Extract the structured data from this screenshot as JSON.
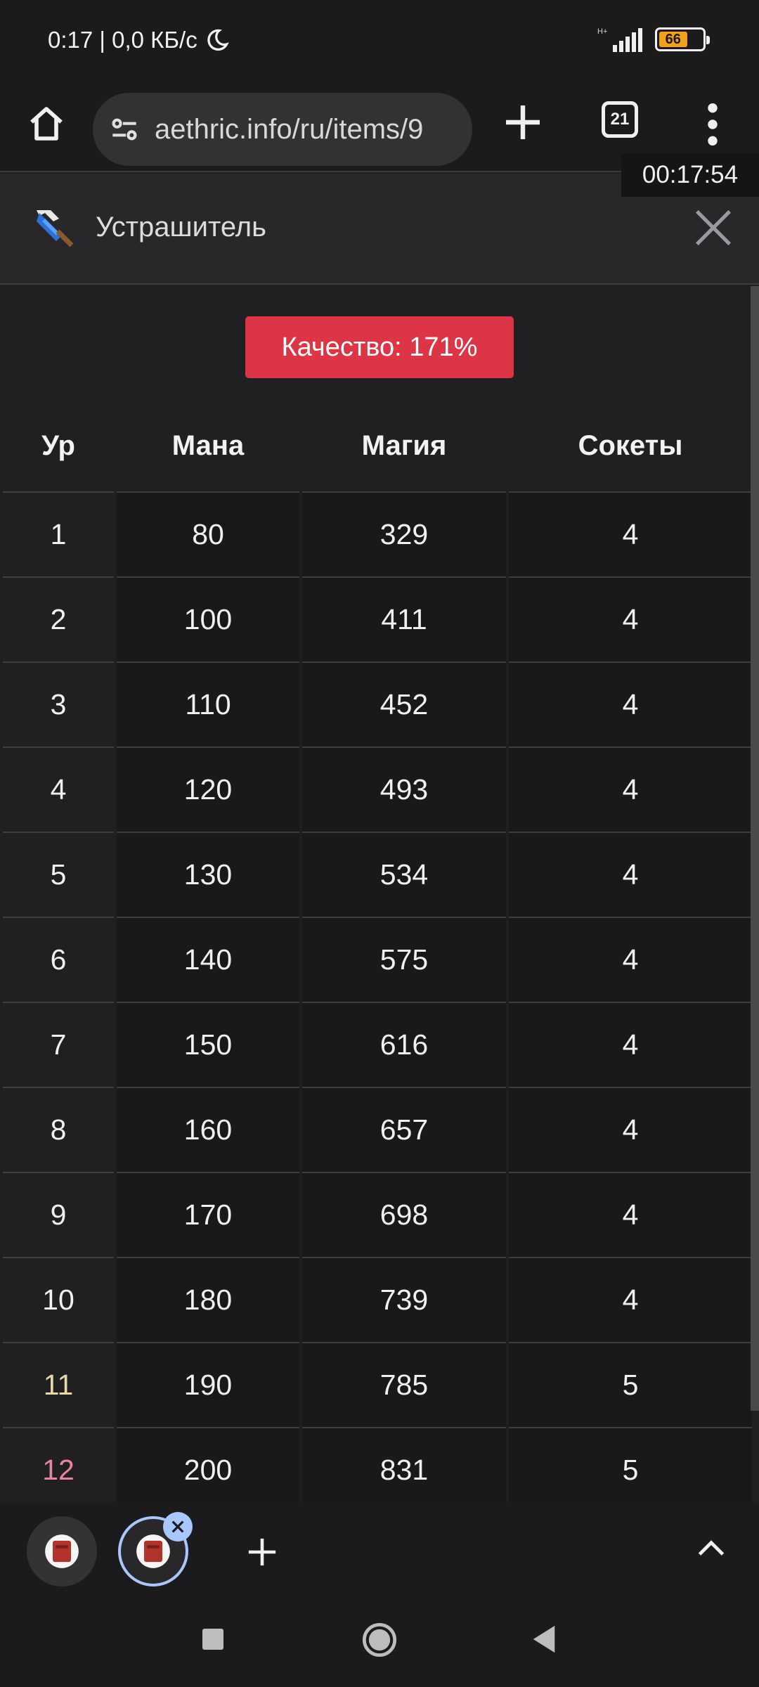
{
  "status_bar": {
    "time_speed": "0:17 | 0,0 КБ/с",
    "network_type": "H+",
    "battery": "66"
  },
  "browser": {
    "url": "aethric.info/ru/items/9",
    "tab_count": "21",
    "clock_overlay": "00:17:54"
  },
  "item": {
    "title": "Устрашитель",
    "quality": "Качество: 171%"
  },
  "table": {
    "headers": [
      "Ур",
      "Мана",
      "Магия",
      "Сокеты"
    ],
    "rows": [
      [
        "1",
        "80",
        "329",
        "4"
      ],
      [
        "2",
        "100",
        "411",
        "4"
      ],
      [
        "3",
        "110",
        "452",
        "4"
      ],
      [
        "4",
        "120",
        "493",
        "4"
      ],
      [
        "5",
        "130",
        "534",
        "4"
      ],
      [
        "6",
        "140",
        "575",
        "4"
      ],
      [
        "7",
        "150",
        "616",
        "4"
      ],
      [
        "8",
        "160",
        "657",
        "4"
      ],
      [
        "9",
        "170",
        "698",
        "4"
      ],
      [
        "10",
        "180",
        "739",
        "4"
      ],
      [
        "11",
        "190",
        "785",
        "5"
      ],
      [
        "12",
        "200",
        "831",
        "5"
      ]
    ]
  },
  "colors": {
    "quality_badge": "#dc3545",
    "level_11": "#e6d9a5",
    "level_12": "#e8849b",
    "active_tab_ring": "#a9c7ff"
  }
}
